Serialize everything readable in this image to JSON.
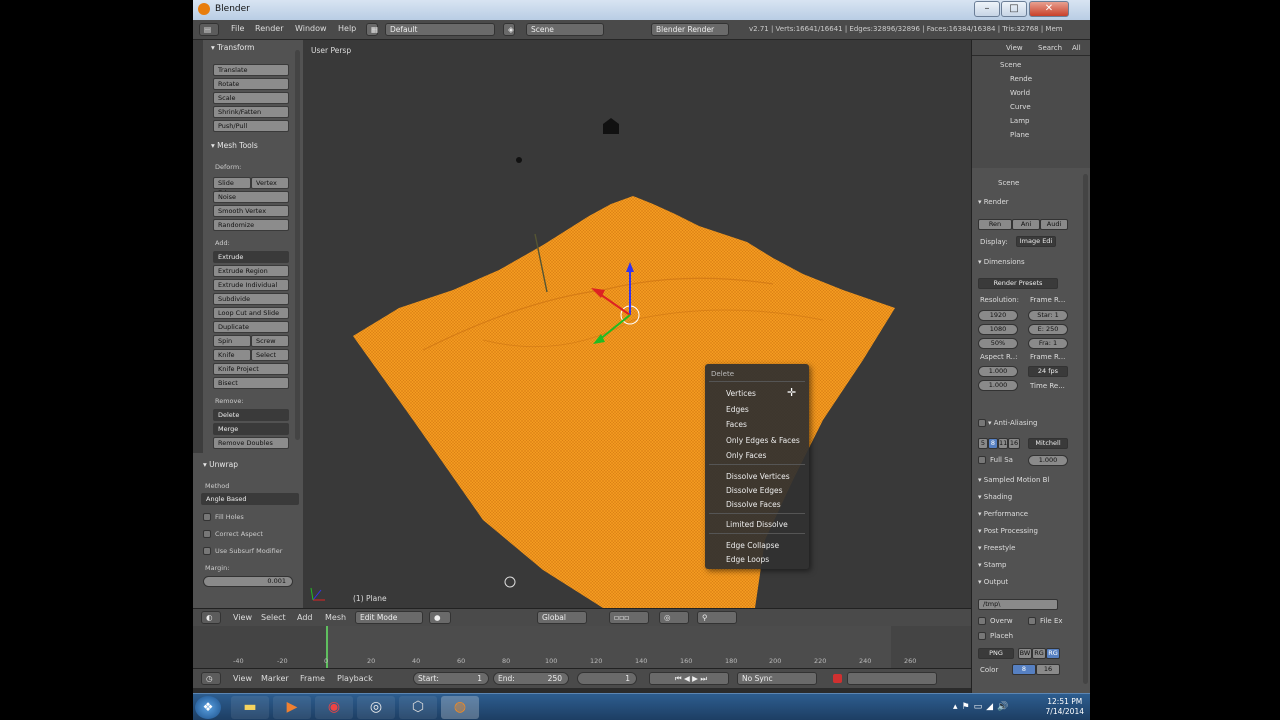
{
  "window": {
    "title": "Blender"
  },
  "topbar": {
    "menus": [
      "File",
      "Render",
      "Window",
      "Help"
    ],
    "layout": "Default",
    "scene": "Scene",
    "engine": "Blender Render",
    "stats": "v2.71 | Verts:16641/16641 | Edges:32896/32896 | Faces:16384/16384 | Tris:32768 | Mem"
  },
  "toolshelf": {
    "transform": {
      "header": "Transform",
      "buttons": [
        "Translate",
        "Rotate",
        "Scale",
        "Shrink/Fatten",
        "Push/Pull"
      ]
    },
    "meshtools": {
      "header": "Mesh Tools",
      "deform_label": "Deform:",
      "deform": [
        "Slide Edge",
        "Vertex",
        "Noise",
        "Smooth Vertex",
        "Randomize"
      ],
      "add_label": "Add:",
      "add": [
        "Extrude",
        "Extrude Region",
        "Extrude Individual",
        "Subdivide",
        "Loop Cut and Slide",
        "Duplicate"
      ],
      "spin": "Spin",
      "screw": "Screw",
      "knife": "Knife",
      "select": "Select",
      "add2": [
        "Knife Project",
        "Bisect"
      ],
      "remove_label": "Remove:",
      "remove": [
        "Delete",
        "Merge",
        "Remove Doubles"
      ]
    },
    "unwrap": {
      "header": "Unwrap",
      "method_label": "Method",
      "method": "Angle Based",
      "fill_holes": "Fill Holes",
      "correct_aspect": "Correct Aspect",
      "use_subsurf": "Use Subsurf Modifier",
      "margin_label": "Margin:",
      "margin": "0.001"
    }
  },
  "viewport": {
    "title": "User Persp",
    "object": "(1) Plane",
    "mesh_color": "#f0961e"
  },
  "delete_menu": {
    "title": "Delete",
    "group1": [
      "Vertices",
      "Edges",
      "Faces",
      "Only Edges & Faces",
      "Only Faces"
    ],
    "group2": [
      "Dissolve Vertices",
      "Dissolve Edges",
      "Dissolve Faces"
    ],
    "group3": [
      "Limited Dissolve"
    ],
    "group4": [
      "Edge Collapse",
      "Edge Loops"
    ]
  },
  "outliner": {
    "menus": [
      "View",
      "Search",
      "All"
    ],
    "items": [
      "Scene",
      "Rende",
      "World",
      "Curve",
      "Lamp",
      "Plane"
    ]
  },
  "properties": {
    "scene": "Scene",
    "render": "Render",
    "render_btns": [
      "Ren",
      "Ani",
      "Audi"
    ],
    "display_label": "Display:",
    "display": "Image Edi",
    "dimensions": "Dimensions",
    "presets": "Render Presets",
    "resolution_label": "Resolution:",
    "frame_range_label": "Frame R...",
    "res_x": "1920",
    "res_y": "1080",
    "res_pct": "50%",
    "start": "Star: 1",
    "end": "E: 250",
    "step": "Fra: 1",
    "aspect_label": "Aspect R..:",
    "frame_rate_label": "Frame R...",
    "aspect_x": "1.000",
    "aspect_y": "1.000",
    "fps": "24 fps",
    "time_label": "Time Re...",
    "anti_aliasing": "Anti-Aliasing",
    "aa_samples": [
      "5",
      "8",
      "11",
      "16"
    ],
    "aa_filter": "Mitchell",
    "full_sample": "Full Sa",
    "aa_size": "1.000",
    "sampled_motion": "Sampled Motion Bl",
    "panels": [
      "Shading",
      "Performance",
      "Post Processing",
      "Freestyle",
      "Stamp"
    ],
    "output": "Output",
    "output_path": "/tmp\\",
    "overwrite": "Overw",
    "file_ext": "File Ex",
    "placeholders": "Placeh",
    "format": "PNG",
    "color": [
      "BW",
      "RG",
      "RG"
    ],
    "color_label": "Color",
    "depth": [
      "8",
      "16"
    ]
  },
  "viewport_header": {
    "menus": [
      "View",
      "Select",
      "Add",
      "Mesh"
    ],
    "mode": "Edit Mode",
    "orientation": "Global"
  },
  "timeline": {
    "ticks": [
      "-40",
      "-20",
      "0",
      "20",
      "40",
      "60",
      "80",
      "100",
      "120",
      "140",
      "160",
      "180",
      "200",
      "220",
      "240",
      "260"
    ],
    "menus": [
      "View",
      "Marker",
      "Frame",
      "Playback"
    ],
    "start": "Start:",
    "start_val": "1",
    "end": "End:",
    "end_val": "250",
    "current": "1",
    "sync": "No Sync"
  },
  "taskbar": {
    "time": "12:51 PM",
    "date": "7/14/2014"
  }
}
